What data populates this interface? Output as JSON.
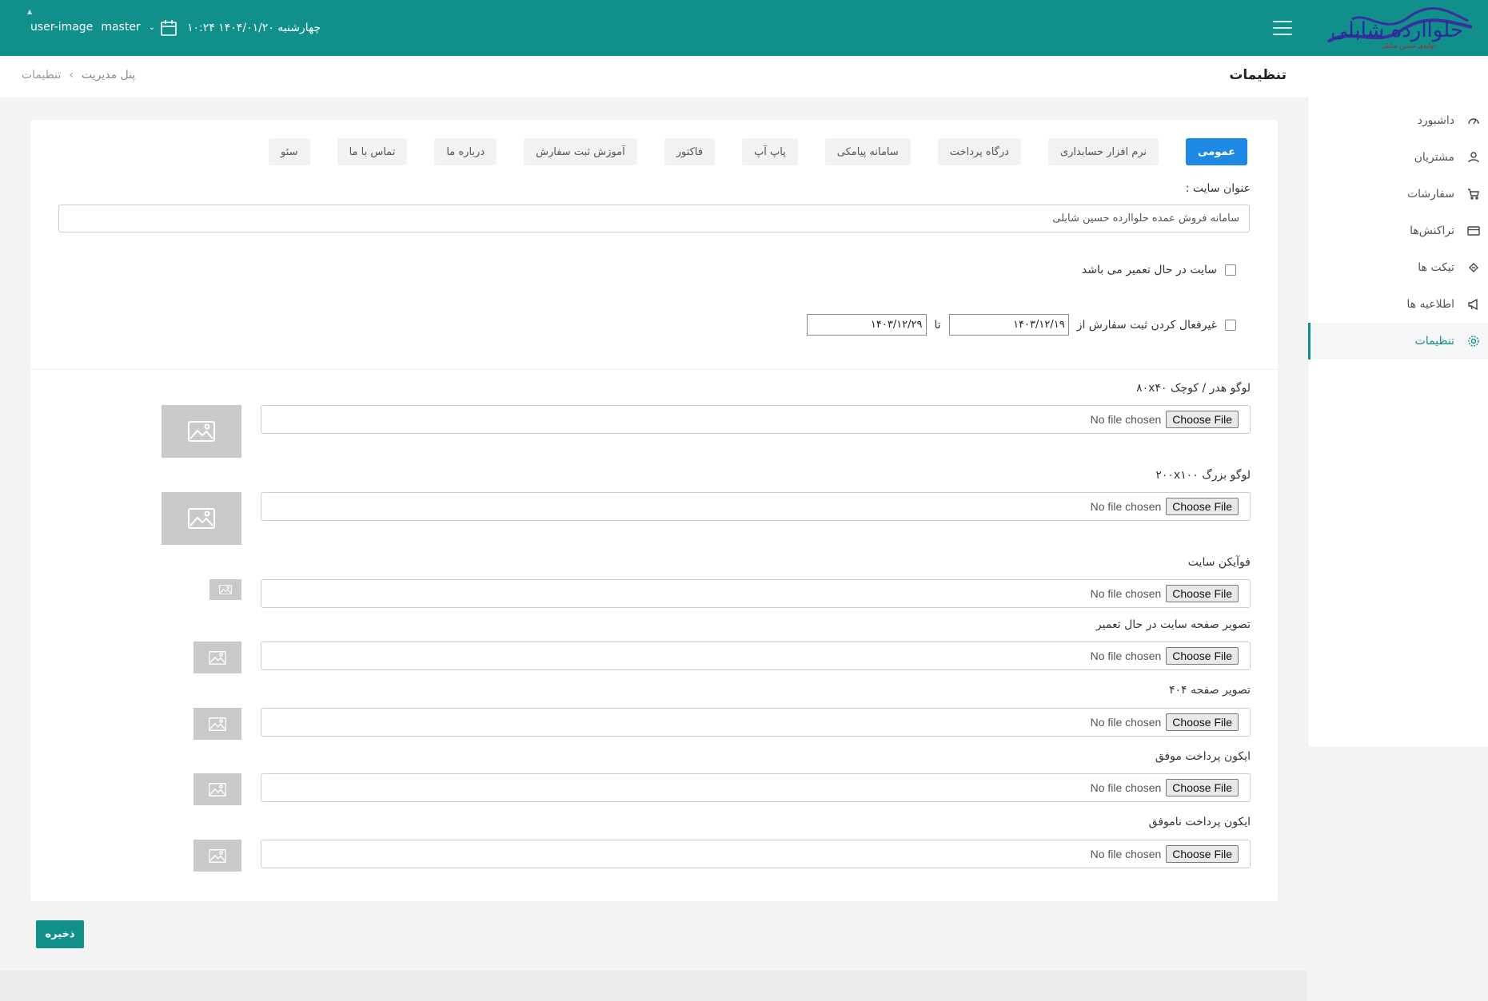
{
  "topbar": {
    "logo_text": "حلواارده شابلی",
    "logo_subtext": "تولیدی حسین شابلی",
    "datetime": "چهارشنبه ۱۴۰۴/۰۱/۲۰ ۱۰:۲۴",
    "branch": "master",
    "user": "user-image",
    "colors": {
      "primary": "#118f8a"
    }
  },
  "header": {
    "title": "تنظیمات",
    "breadcrumb": [
      "پنل مدیریت",
      "تنظیمات"
    ]
  },
  "sidebar": {
    "items": [
      {
        "label": "داشبورد",
        "icon": "dashboard-icon"
      },
      {
        "label": "مشتریان",
        "icon": "users-icon"
      },
      {
        "label": "سفارشات",
        "icon": "cart-icon"
      },
      {
        "label": "تراکنش‌ها",
        "icon": "credit-card-icon"
      },
      {
        "label": "تیکت ها",
        "icon": "ticket-icon"
      },
      {
        "label": "اطلاعیه ها",
        "icon": "megaphone-icon"
      },
      {
        "label": "تنظیمات",
        "icon": "gear-icon",
        "active": true
      }
    ]
  },
  "tabs": [
    "عمومی",
    "نرم افزار حسابداری",
    "درگاه پرداخت",
    "سامانه پیامکی",
    "پاپ آپ",
    "فاکتور",
    "آموزش ثبت سفارش",
    "درباره ما",
    "تماس با ما",
    "سئو"
  ],
  "form": {
    "site_title_label": "عنوان سایت :",
    "site_title_value": "سامانه فروش عمده حلواارده حسین شابلی",
    "maintenance_label": "سایت در حال تعمیر می باشد",
    "disable_order_label": "غیرفعال کردن ثبت سفارش از",
    "to_label": "تا",
    "date_from": "۱۴۰۳/۱۲/۱۹",
    "date_to": "۱۴۰۳/۱۲/۲۹",
    "uploads": [
      {
        "label": "لوگو هدر / کوچک ۸۰x۴۰"
      },
      {
        "label": "لوگو بزرگ ۲۰۰x۱۰۰"
      },
      {
        "label": "فوآیکن سایت"
      },
      {
        "label": "تصویر صفحه سایت در حال تعمیر"
      },
      {
        "label": "تصویر صفحه ۴۰۴"
      },
      {
        "label": "ایکون پرداخت موفق"
      },
      {
        "label": "ایکون پرداخت ناموفق"
      }
    ],
    "file_button": "Choose File",
    "file_status": "No file chosen",
    "save_label": "ذخیره"
  }
}
